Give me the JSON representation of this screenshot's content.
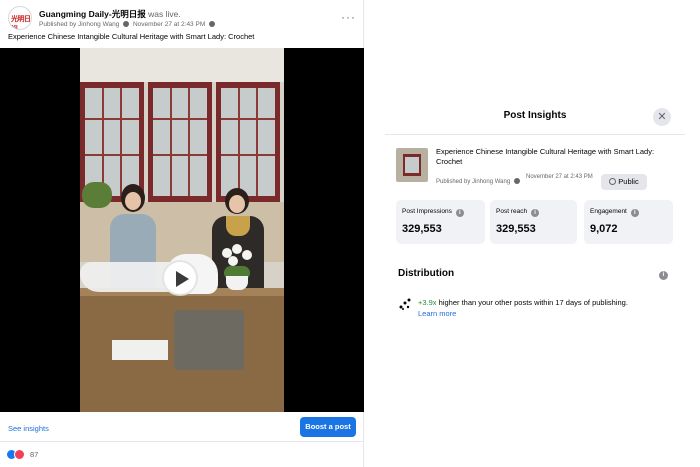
{
  "post": {
    "page_name": "Guangming Daily-光明日报",
    "status_suffix": "was live.",
    "published_by": "Published by Jinhong Wang",
    "date": "November 27 at 2:43 PM",
    "text": "Experience Chinese Intangible Cultural Heritage with Smart Lady: Crochet",
    "more_label": "···",
    "avatar_logo_text": "光明日报",
    "actions": {
      "see_insights": "See insights",
      "boost": "Boost a post"
    },
    "reactions": {
      "count": "87"
    }
  },
  "insights": {
    "title": "Post Insights",
    "close_label": "✕",
    "video_title": "Experience Chinese Intangible Cultural Heritage with Smart Lady: Crochet",
    "published_by": "Published by Jinhong Wang",
    "date": "November 27 at 2:43 PM",
    "visibility": "Public",
    "metrics": [
      {
        "label": "Post Impressions",
        "value": "329,553"
      },
      {
        "label": "Post reach",
        "value": "329,553"
      },
      {
        "label": "Engagement",
        "value": "9,072"
      }
    ],
    "distribution": {
      "title": "Distribution",
      "multiplier": "+3.9x",
      "text": " higher than your other posts within 17 days of publishing.",
      "learn_more": "Learn more"
    }
  },
  "colors": {
    "accent": "#1b74e4",
    "link": "#216fdb",
    "positive": "#2e8b3e",
    "surface": "#f0f2f5"
  },
  "icons": [
    "more-icon",
    "play-icon",
    "close-icon",
    "globe-icon",
    "info-icon",
    "distribution-icon",
    "like-reaction-icon",
    "love-reaction-icon"
  ]
}
